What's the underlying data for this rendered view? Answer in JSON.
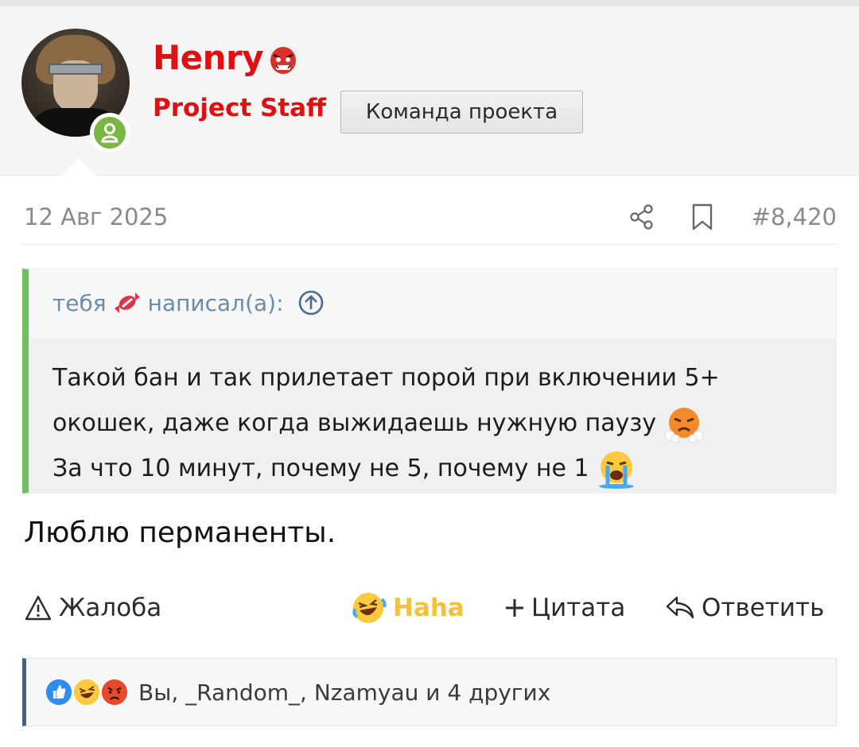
{
  "user": {
    "name": "Henry",
    "name_emoji": "ogre-emoji",
    "title": "Project Staff",
    "banner": "Команда проекта"
  },
  "post": {
    "date": "12 Авг 2025",
    "number": "#8,420",
    "text": "Люблю перманенты."
  },
  "quote": {
    "author": "тебя",
    "author_emoji": "candy-emoji",
    "wrote": "написал(а):",
    "lines": [
      "Такой бан и так прилетает порой при включении 5+",
      "окошек, даже когда выжидаешь нужную паузу",
      "За что 10 минут, почему не 5, почему не 1"
    ]
  },
  "actions": {
    "report": "Жалоба",
    "haha": "Haha",
    "quote": "Цитата",
    "reply": "Ответить"
  },
  "reactions": {
    "icons": [
      "like-icon",
      "haha-icon",
      "angry-icon"
    ],
    "text": "Вы, _Random_, Nzamyau и 4 других"
  },
  "colors": {
    "username": "#dd1111",
    "quote_bar": "#6cc060",
    "haha": "#f4c13c",
    "online": "#7ab643",
    "reaction_bar": "#47627e"
  }
}
